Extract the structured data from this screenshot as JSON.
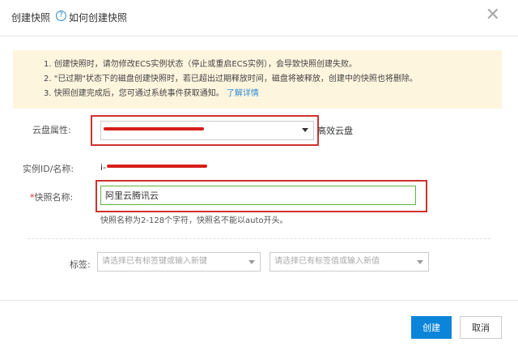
{
  "header": {
    "title": "创建快照",
    "help_link": "如何创建快照",
    "close_glyph": "✕"
  },
  "notice": {
    "lines": [
      "1. 创建快照时，请勿修改ECS实例状态（停止或重启ECS实例），会导致快照创建失败。",
      "2. \"已过期\"状态下的磁盘创建快照时，若已超出过期释放时间，磁盘将被释放，创建中的快照也将删除。",
      "3. 快照创建完成后，您可通过系统事件获取通知。"
    ],
    "learn_more": "了解详情"
  },
  "form": {
    "disk_label": "云盘属性:",
    "disk_type": "高效云盘",
    "instance_label": "实例ID/名称:",
    "instance_value_prefix": "i-",
    "name_label": "*快照名称:",
    "name_value": "阿里云腾讯云",
    "name_hint": "快照名称为2-128个字符，快照名不能以auto开头。",
    "tag_label": "标签:",
    "tag_key_placeholder": "请选择已有标签键或输入新键",
    "tag_value_placeholder": "请选择已有标签值或输入新值"
  },
  "footer": {
    "create_label": "创建",
    "cancel_label": "取消"
  },
  "colors": {
    "primary": "#0a85d9",
    "highlight_red": "#d0322e",
    "notice_bg": "#fdf5de",
    "link": "#2e8bd6"
  }
}
